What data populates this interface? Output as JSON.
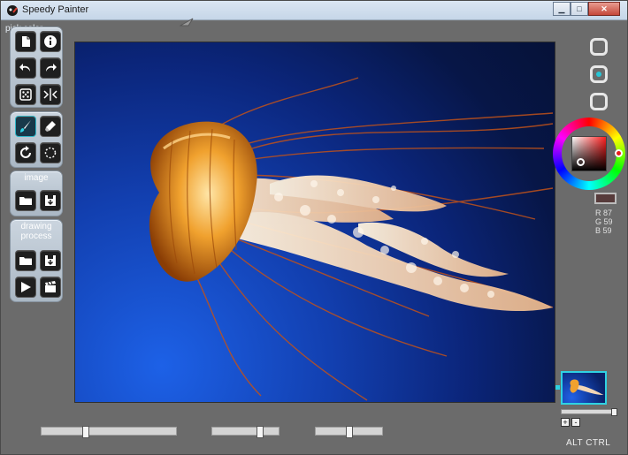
{
  "window": {
    "title": "Speedy Painter",
    "min_glyph": "▁",
    "max_glyph": "□",
    "close_glyph": "✕"
  },
  "toolbar": {
    "pick_color_label": "pick color",
    "image_group_label": "image",
    "drawing_process_label_line1": "drawing",
    "drawing_process_label_line2": "process"
  },
  "color": {
    "selected_hex": "#573B3B",
    "r_label": "R 87",
    "g_label": "G 59",
    "b_label": "B 59"
  },
  "zoom": {
    "plus_label": "+",
    "minus_label": "-",
    "thumbnail_slider_value_pct": 100
  },
  "modifiers_label": "ALT  CTRL",
  "sliders": [
    {
      "name": "brush-size",
      "value_pct": 32
    },
    {
      "name": "opacity",
      "value_pct": 75
    },
    {
      "name": "hardness",
      "value_pct": 50
    }
  ],
  "icons": {
    "new": "new-document-icon",
    "info": "info-icon",
    "undo": "undo-icon",
    "redo": "redo-icon",
    "random": "dice-icon",
    "flip": "flip-horizontal-icon",
    "brush": "brush-icon",
    "eraser": "eraser-icon",
    "rotate": "rotate-icon",
    "lasso": "lasso-icon",
    "open": "folder-icon",
    "save": "save-icon",
    "play": "play-icon",
    "record": "clapper-icon"
  }
}
